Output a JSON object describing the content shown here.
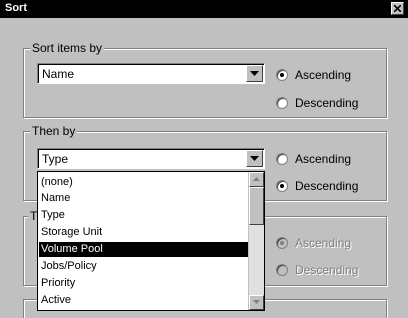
{
  "window": {
    "title": "Sort"
  },
  "sort_group": {
    "label": "Sort items by",
    "combo_value": "Name",
    "ascending": "Ascending",
    "descending": "Descending",
    "selected": "Ascending"
  },
  "then_group": {
    "label": "Then by",
    "combo_value": "Type",
    "ascending": "Ascending",
    "descending": "Descending",
    "selected": "Descending"
  },
  "third_group": {
    "label": "T",
    "ascending": "Ascending",
    "descending": "Descending",
    "selected": "Ascending",
    "disabled": true
  },
  "dropdown": {
    "items": [
      "(none)",
      "Name",
      "Type",
      "Storage Unit",
      "Volume Pool",
      "Jobs/Policy",
      "Priority",
      "Active"
    ],
    "selected": "Volume Pool"
  }
}
